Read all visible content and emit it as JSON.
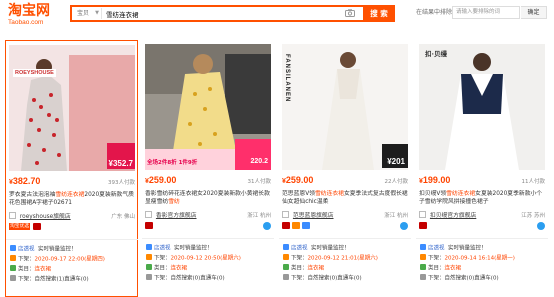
{
  "header": {
    "logo_cn": "淘宝网",
    "logo_en": "Taobao.com",
    "search_category": "宝贝",
    "search_value": "雪纺连衣裙",
    "search_button": "搜 索",
    "sub_search_label": "在结果中排除",
    "sub_search_placeholder": "请输入要排除的词",
    "sub_search_button": "确定"
  },
  "cards": [
    {
      "brand_text": "ROEYSHOUSE",
      "promo_price": "352.7",
      "price": "382.70",
      "sold": "393人付款",
      "title_pre": "罗衣夏古法泡泡袖",
      "title_hl1": "雪纺连衣裙",
      "title_mid": "2020夏装新款气质花色围裙A字裙子02671",
      "shop": "roeyshouse旗舰店",
      "location": "广东 佛山",
      "tag1": "淘宝优选",
      "info": {
        "l1_label": "店透视",
        "l1_sep": "实时销量监控！",
        "l2_label": "下架：",
        "l2_value": "2020-09-17 22:00(星期四)",
        "l3_label": "类目：",
        "l3_value": "连衣裙",
        "l4_label": "下架：",
        "l4_value": "自然搜索(1)直通车(0)"
      }
    },
    {
      "promo_price": "220.2",
      "promo_text": "全场2件8折 1件9折",
      "price": "259.00",
      "sold": "31人付款",
      "title_pre": "香影雪纺碎花连衣裙女2020夏装新款小黄裙长款显瘦雪纺",
      "title_hl1": "雪纺",
      "title_mid": "",
      "shop": "香影官方旗舰店",
      "location": "浙江 杭州",
      "tag1": "",
      "info": {
        "l1_label": "店透视",
        "l1_sep": "实时销量监控！",
        "l2_label": "下架：",
        "l2_value": "2020-09-12 20:50(星期六)",
        "l3_label": "类目：",
        "l3_value": "连衣裙",
        "l4_label": "下架：",
        "l4_value": "自然搜索(0)直通车(0)"
      }
    },
    {
      "brand_text": "FANSILANEN",
      "promo_price": "201",
      "price": "259.00",
      "sold": "22人付款",
      "title_pre": "范思蓝恩V领",
      "title_hl1": "雪纺连衣裙",
      "title_mid": "女夏季法式复古度假长裙仙女超仙chic温柔",
      "shop": "范思蓝恩旗舰店",
      "location": "浙江 杭州",
      "tag1": "",
      "info": {
        "l1_label": "店透视",
        "l1_sep": "实时销量监控！",
        "l2_label": "下架：",
        "l2_value": "2020-09-12 21:01(星期六)",
        "l3_label": "类目：",
        "l3_value": "连衣裙",
        "l4_label": "下架：",
        "l4_value": "自然搜索(0)直通车(0)"
      }
    },
    {
      "brand_text": "扣·贝缦",
      "price": "199.00",
      "sold": "11人付款",
      "title_pre": "扣贝缦V领",
      "title_hl1": "雪纺连衣裙",
      "title_mid": "女夏装2020夏季新款小个子雪纺学院风拼接撞色裙子",
      "shop": "扣贝缦官方旗舰店",
      "location": "江苏 苏州",
      "tag1": "",
      "info": {
        "l1_label": "店透视",
        "l1_sep": "实时销量监控！",
        "l2_label": "下架：",
        "l2_value": "2020-09-14 16:14(星期一)",
        "l3_label": "类目：",
        "l3_value": "连衣裙",
        "l4_label": "下架：",
        "l4_value": "自然搜索(0)直通车(0)"
      }
    }
  ],
  "colors": {
    "brand": "#ff5000",
    "price": "#ff4400"
  }
}
